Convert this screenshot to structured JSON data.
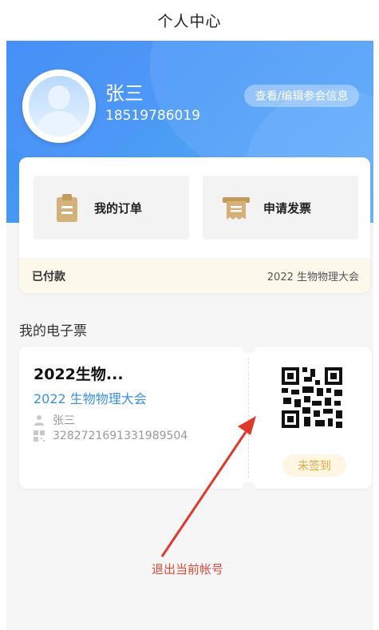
{
  "header": {
    "title": "个人中心"
  },
  "profile": {
    "name": "张三",
    "phone": "18519786019",
    "edit_button": "查看/编辑参会信息"
  },
  "actions": {
    "orders_label": "我的订单",
    "invoice_label": "申请发票"
  },
  "payment_status": {
    "status": "已付款",
    "event": "2022 生物物理大会"
  },
  "tickets_section": {
    "title": "我的电子票",
    "ticket": {
      "title": "2022生物...",
      "event": "2022 生物物理大会",
      "attendee": "张三",
      "code": "3282721691331989504",
      "checkin_status": "未签到"
    }
  },
  "logout": {
    "label": "退出当前帐号"
  },
  "colors": {
    "primary_blue": "#4a9cf5",
    "link_blue": "#3a8ee6",
    "accent_red": "#e04a3a",
    "badge_orange": "#e7a83c",
    "icon_tan": "#d4b07a"
  }
}
